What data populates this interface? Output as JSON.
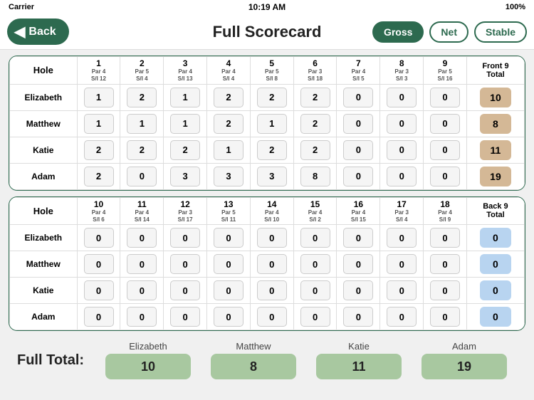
{
  "statusBar": {
    "carrier": "Carrier",
    "wifi": "wifi",
    "time": "10:19 AM",
    "battery": "100%"
  },
  "header": {
    "backLabel": "Back",
    "title": "Full Scorecard",
    "scoreTypes": [
      "Gross",
      "Net",
      "Stable"
    ],
    "activeType": "Gross"
  },
  "front9": {
    "sectionLabel": "Hole",
    "totalLabel": "Front 9\nTotal",
    "holes": [
      {
        "num": "1",
        "par": "Par 4",
        "si": "S/I 12"
      },
      {
        "num": "2",
        "par": "Par 5",
        "si": "S/I 4"
      },
      {
        "num": "3",
        "par": "Par 4",
        "si": "S/I 13"
      },
      {
        "num": "4",
        "par": "Par 4",
        "si": "S/I 4"
      },
      {
        "num": "5",
        "par": "Par 5",
        "si": "S/I 8"
      },
      {
        "num": "6",
        "par": "Par 3",
        "si": "S/I 18"
      },
      {
        "num": "7",
        "par": "Par 4",
        "si": "S/I 5"
      },
      {
        "num": "8",
        "par": "Par 3",
        "si": "S/I 3"
      },
      {
        "num": "9",
        "par": "Par 5",
        "si": "S/I 16"
      }
    ],
    "players": [
      {
        "name": "Elizabeth",
        "scores": [
          1,
          2,
          1,
          2,
          2,
          2,
          0,
          0,
          0
        ],
        "total": "10"
      },
      {
        "name": "Matthew",
        "scores": [
          1,
          1,
          1,
          2,
          1,
          2,
          0,
          0,
          0
        ],
        "total": "8"
      },
      {
        "name": "Katie",
        "scores": [
          2,
          2,
          2,
          1,
          2,
          2,
          0,
          0,
          0
        ],
        "total": "11"
      },
      {
        "name": "Adam",
        "scores": [
          2,
          0,
          3,
          3,
          3,
          8,
          0,
          0,
          0
        ],
        "total": "19"
      }
    ]
  },
  "back9": {
    "sectionLabel": "Hole",
    "totalLabel": "Back 9\nTotal",
    "holes": [
      {
        "num": "10",
        "par": "Par 4",
        "si": "S/I 6"
      },
      {
        "num": "11",
        "par": "Par 4",
        "si": "S/I 14"
      },
      {
        "num": "12",
        "par": "Par 3",
        "si": "S/I 17"
      },
      {
        "num": "13",
        "par": "Par 5",
        "si": "S/I 11"
      },
      {
        "num": "14",
        "par": "Par 4",
        "si": "S/I 10"
      },
      {
        "num": "15",
        "par": "Par 4",
        "si": "S/I 2"
      },
      {
        "num": "16",
        "par": "Par 4",
        "si": "S/I 15"
      },
      {
        "num": "17",
        "par": "Par 3",
        "si": "S/I 4"
      },
      {
        "num": "18",
        "par": "Par 4",
        "si": "S/I 9"
      }
    ],
    "players": [
      {
        "name": "Elizabeth",
        "scores": [
          0,
          0,
          0,
          0,
          0,
          0,
          0,
          0,
          0
        ],
        "total": "0"
      },
      {
        "name": "Matthew",
        "scores": [
          0,
          0,
          0,
          0,
          0,
          0,
          0,
          0,
          0
        ],
        "total": "0"
      },
      {
        "name": "Katie",
        "scores": [
          0,
          0,
          0,
          0,
          0,
          0,
          0,
          0,
          0
        ],
        "total": "0"
      },
      {
        "name": "Adam",
        "scores": [
          0,
          0,
          0,
          0,
          0,
          0,
          0,
          0,
          0
        ],
        "total": "0"
      }
    ]
  },
  "fullTotal": {
    "label": "Full Total:",
    "players": [
      {
        "name": "Elizabeth",
        "total": "10"
      },
      {
        "name": "Matthew",
        "total": "8"
      },
      {
        "name": "Katie",
        "total": "11"
      },
      {
        "name": "Adam",
        "total": "19"
      }
    ]
  }
}
